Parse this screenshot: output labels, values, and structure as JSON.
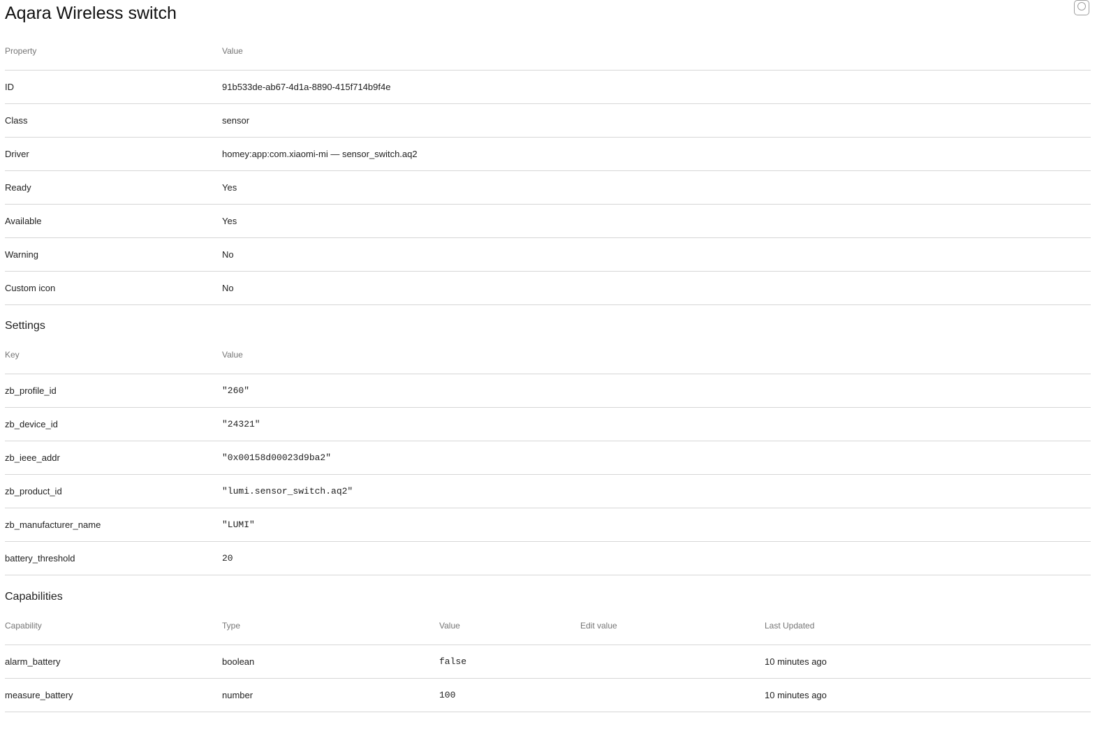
{
  "title": "Aqara Wireless switch",
  "properties": {
    "headers": [
      "Property",
      "Value"
    ],
    "rows": [
      {
        "property": "ID",
        "value": "91b533de-ab67-4d1a-8890-415f714b9f4e"
      },
      {
        "property": "Class",
        "value": "sensor"
      },
      {
        "property": "Driver",
        "value": "homey:app:com.xiaomi-mi — sensor_switch.aq2"
      },
      {
        "property": "Ready",
        "value": "Yes"
      },
      {
        "property": "Available",
        "value": "Yes"
      },
      {
        "property": "Warning",
        "value": "No"
      },
      {
        "property": "Custom icon",
        "value": "No"
      }
    ]
  },
  "settings": {
    "title": "Settings",
    "headers": [
      "Key",
      "Value"
    ],
    "rows": [
      {
        "key": "zb_profile_id",
        "value": "\"260\""
      },
      {
        "key": "zb_device_id",
        "value": "\"24321\""
      },
      {
        "key": "zb_ieee_addr",
        "value": "\"0x00158d00023d9ba2\""
      },
      {
        "key": "zb_product_id",
        "value": "\"lumi.sensor_switch.aq2\""
      },
      {
        "key": "zb_manufacturer_name",
        "value": "\"LUMI\""
      },
      {
        "key": "battery_threshold",
        "value": "20"
      }
    ]
  },
  "capabilities": {
    "title": "Capabilities",
    "headers": [
      "Capability",
      "Type",
      "Value",
      "Edit value",
      "Last Updated"
    ],
    "rows": [
      {
        "capability": "alarm_battery",
        "type": "boolean",
        "value": "false",
        "edit": "",
        "updated": "10 minutes ago"
      },
      {
        "capability": "measure_battery",
        "type": "number",
        "value": "100",
        "edit": "",
        "updated": "10 minutes ago"
      }
    ]
  },
  "colors": {
    "string_value": "#6a9a28",
    "number_value": "#c2185b",
    "boolean_value": "#e65100",
    "divider": "#d6d6d6",
    "header_text": "#757575"
  },
  "icons": {
    "corner_button": "circle-icon"
  }
}
